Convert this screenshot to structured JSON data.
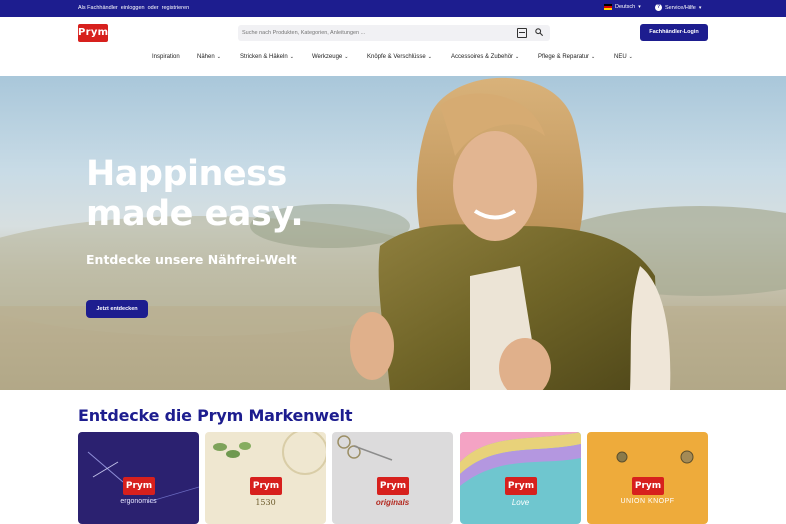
{
  "topbar": {
    "login_prefix": "Als Fachhändler",
    "login_link": "einloggen",
    "or": "oder",
    "register_link": "registrieren",
    "language": "Deutsch",
    "service": "Service/Hilfe"
  },
  "header": {
    "logo_text": "Prym",
    "search_placeholder": "Suche nach Produkten, Kategorien, Anleitungen ...",
    "dealer_login": "Fachhändler-Login"
  },
  "nav": [
    {
      "label": "Inspiration",
      "has_menu": false
    },
    {
      "label": "Nähen",
      "has_menu": true
    },
    {
      "label": "Stricken & Häkeln",
      "has_menu": true
    },
    {
      "label": "Werkzeuge",
      "has_menu": true
    },
    {
      "label": "Knöpfe & Verschlüsse",
      "has_menu": true
    },
    {
      "label": "Accessoires & Zubehör",
      "has_menu": true
    },
    {
      "label": "Pflege & Reparatur",
      "has_menu": true
    },
    {
      "label": "NEU",
      "has_menu": true
    }
  ],
  "hero": {
    "title_line1": "Happiness",
    "title_line2": "made easy.",
    "subtitle": "Entdecke unsere Nähfrei-Welt",
    "cta": "Jetzt entdecken"
  },
  "brands": {
    "title": "Entdecke die Prym Markenwelt",
    "tiles": [
      {
        "logo": "Prym",
        "tag": "ergonomics",
        "bg": "#2b2170"
      },
      {
        "logo": "Prym",
        "tag": "1530",
        "bg": "#efe7d0"
      },
      {
        "logo": "Prym",
        "tag": "originals",
        "bg": "#dcdbdc"
      },
      {
        "logo": "Prym",
        "tag": "Love",
        "bg": "#6fc6cf"
      },
      {
        "logo": "Prym",
        "tag": "UNION KNOPF",
        "bg": "#eeab3b"
      }
    ]
  },
  "colors": {
    "brand_blue": "#1d1d8f",
    "brand_red": "#d7201d"
  }
}
